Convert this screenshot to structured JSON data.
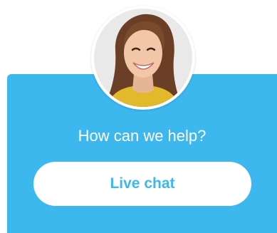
{
  "widget": {
    "headline": "How can we help?",
    "button_label": "Live chat",
    "avatar_icon": "agent-avatar-photo"
  },
  "colors": {
    "accent": "#3cb8ee",
    "button_bg": "#ffffff",
    "text_on_accent": "#ffffff"
  }
}
